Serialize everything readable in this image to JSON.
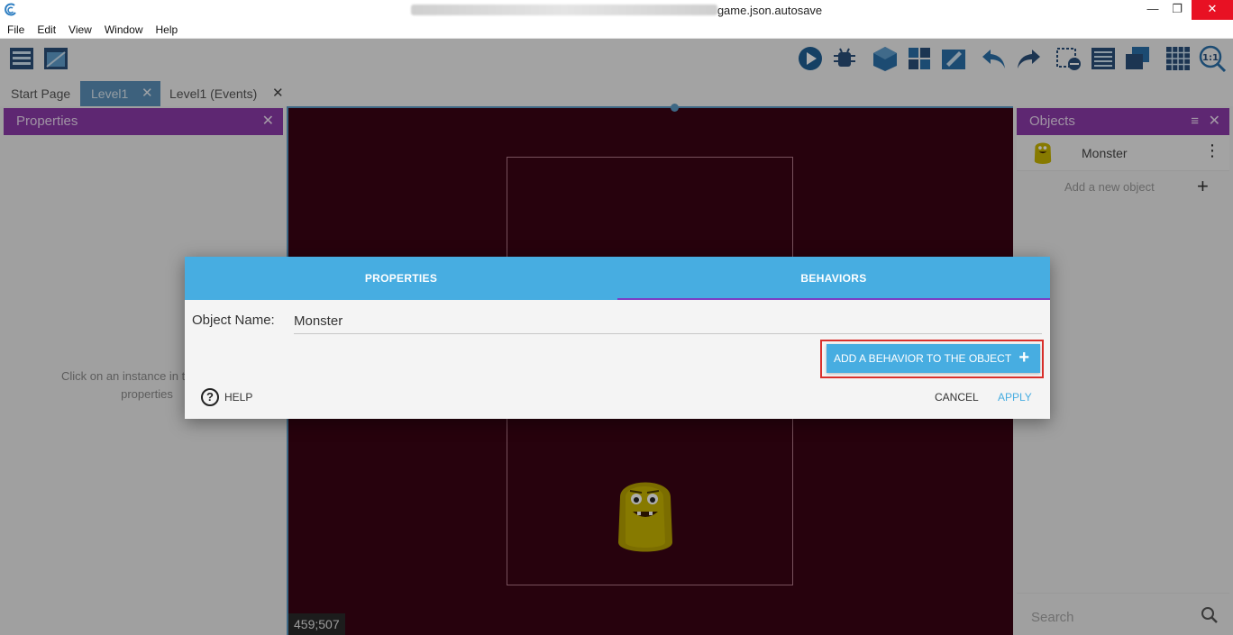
{
  "window": {
    "title": "game.json.autosave",
    "minimize": "—",
    "maximize": "❐",
    "close": "✕"
  },
  "menu": [
    "File",
    "Edit",
    "View",
    "Window",
    "Help"
  ],
  "tabs": [
    {
      "label": "Start Page"
    },
    {
      "label": "Level1"
    },
    {
      "label": "Level1 (Events)"
    }
  ],
  "properties_panel": {
    "title": "Properties",
    "hint_line1": "Click on an instance in the scene",
    "hint_line2": "properties"
  },
  "objects_panel": {
    "title": "Objects",
    "items": [
      {
        "name": "Monster"
      }
    ],
    "add_label": "Add a new object",
    "search_placeholder": "Search"
  },
  "scene": {
    "coords": "459;507",
    "background": "#3a0414"
  },
  "dialog": {
    "tabs": [
      {
        "label": "PROPERTIES"
      },
      {
        "label": "BEHAVIORS"
      }
    ],
    "object_name_label": "Object Name:",
    "object_name_value": "Monster",
    "add_behavior_label": "ADD A BEHAVIOR TO THE OBJECT",
    "help_label": "HELP",
    "cancel_label": "CANCEL",
    "apply_label": "APPLY"
  },
  "colors": {
    "accent": "#47ade1",
    "panel_header": "#8b3aa8",
    "highlight": "#d9302c"
  }
}
